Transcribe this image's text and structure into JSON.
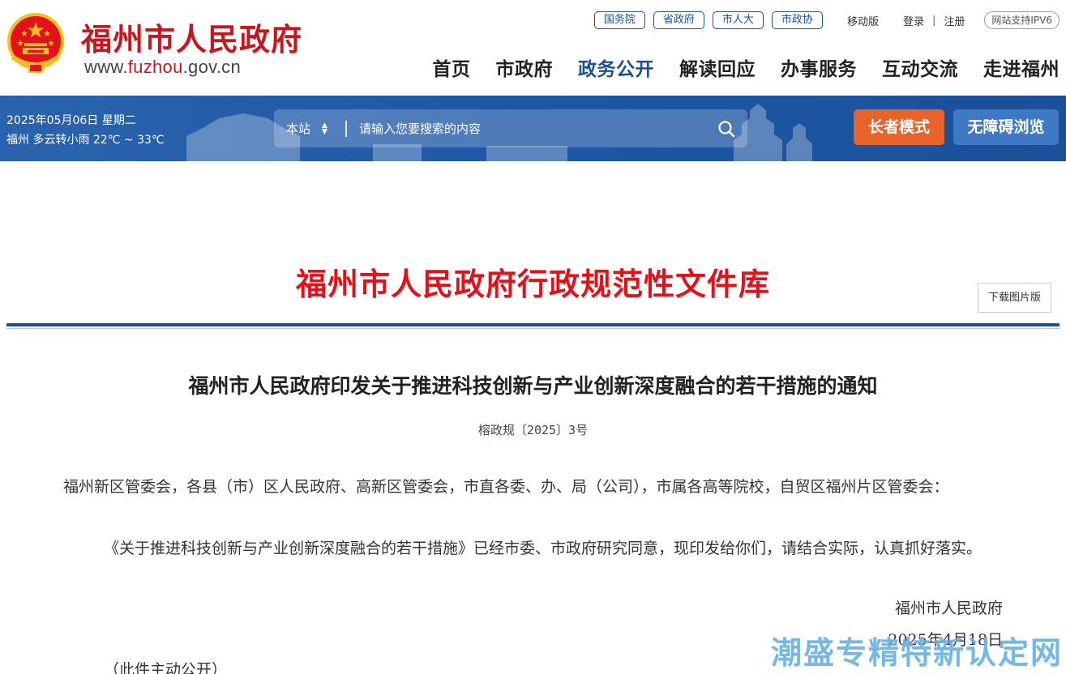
{
  "header": {
    "site_name": "福州市人民政府",
    "url_prefix": "www.",
    "url_highlight": "fuzhou",
    "url_suffix": ".gov.cn",
    "top_pills": [
      "国务院",
      "省政府",
      "市人大",
      "市政协"
    ],
    "mobile_label": "移动版",
    "login_label": "登录",
    "separator": "|",
    "register_label": "注册",
    "ipv6_label": "网站支持IPV6",
    "nav": [
      "首页",
      "市政府",
      "政务公开",
      "解读回应",
      "办事服务",
      "互动交流",
      "走进福州"
    ],
    "active_nav": "政务公开"
  },
  "banner": {
    "date_line": "2025年05月06日 星期二",
    "weather_line": "福州 多云转小雨 22℃ ~ 33℃",
    "search_scope": "本站",
    "search_placeholder": "请输入您要搜索的内容",
    "elder_mode_label": "长者模式",
    "accessibility_label": "无障碍浏览"
  },
  "content": {
    "library_title": "福州市人民政府行政规范性文件库",
    "download_label": "下载图片版",
    "doc_title": "福州市人民政府印发关于推进科技创新与产业创新深度融合的若干措施的通知",
    "doc_number": "榕政规〔2025〕3号",
    "addressee": "福州新区管委会，各县（市）区人民政府、高新区管委会，市直各委、办、局（公司），市属各高等院校，自贸区福州片区管委会：",
    "main_paragraph": "《关于推进科技创新与产业创新深度融合的若干措施》已经市委、市政府研究同意，现印发给你们，请结合实际，认真抓好落实。",
    "signature_org": "福州市人民政府",
    "signature_date": "2025年4月18日",
    "note": "（此件主动公开）"
  },
  "watermark": "潮盛专精特新认定网",
  "colors": {
    "brand_red": "#c8161d",
    "brand_blue": "#1d4f97",
    "elder_orange": "#e8632a",
    "watermark_blue": "#6ab3e6"
  }
}
